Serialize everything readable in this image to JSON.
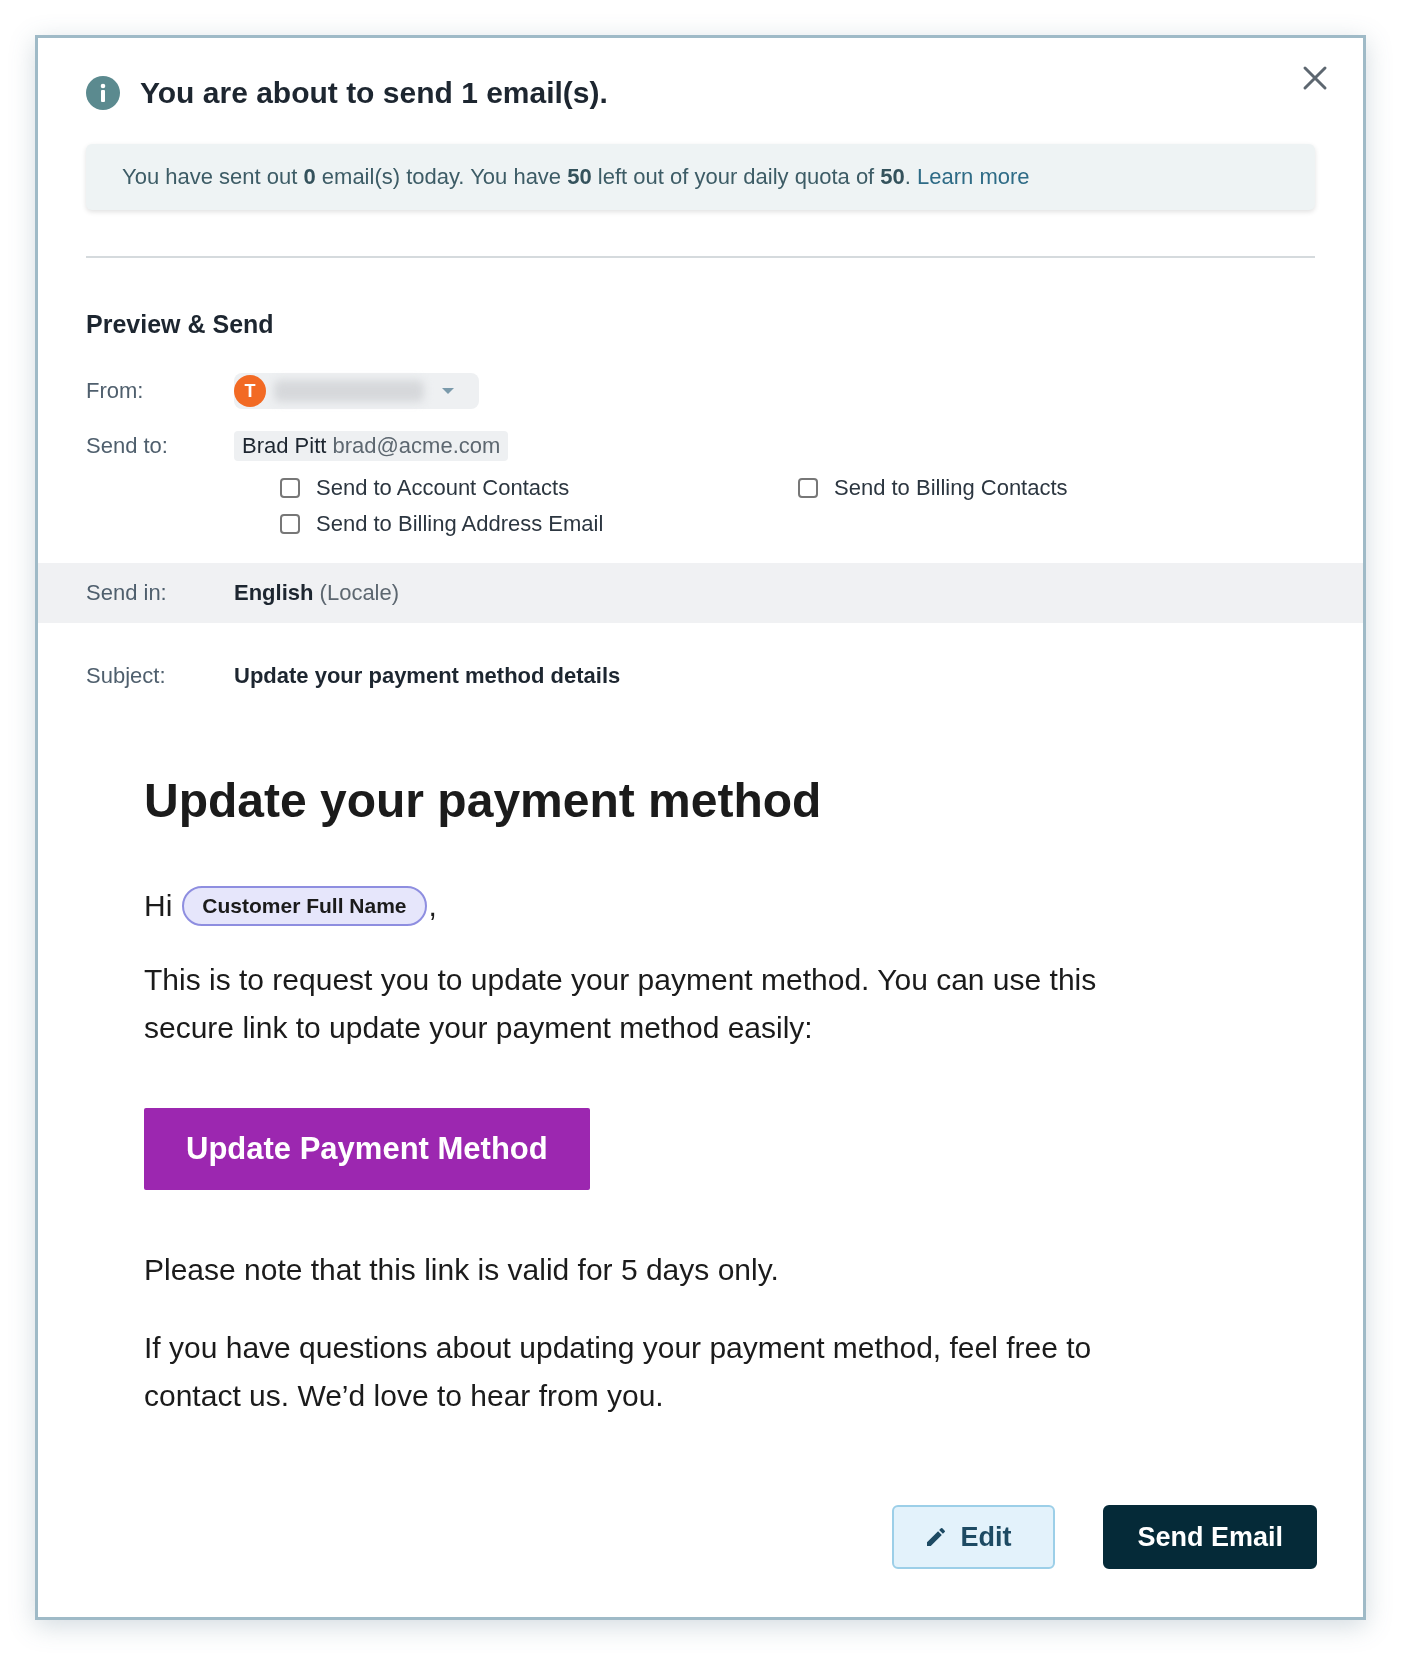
{
  "dialog": {
    "title": "You are about to send 1 email(s)."
  },
  "quota_banner": {
    "text": "You have sent out **0** email(s) today. You have **50** left out of your daily quota of **50**.",
    "link": "Learn more"
  },
  "section_title": "Preview & Send",
  "from": {
    "label": "From:",
    "avatar_letter": "T"
  },
  "send_to": {
    "label": "Send to:",
    "name": "Brad Pitt",
    "email": "brad@acme.com",
    "options": [
      {
        "label": "Send to Account Contacts",
        "checked": false
      },
      {
        "label": "Send to Billing Contacts",
        "checked": false
      },
      {
        "label": "Send to Billing Address Email",
        "checked": false
      }
    ]
  },
  "send_in": {
    "label": "Send in:",
    "language": "English",
    "note": "(Locale)"
  },
  "subject": {
    "label": "Subject:",
    "value": "Update your payment method details"
  },
  "email": {
    "heading": "Update your payment method",
    "greeting": "Hi",
    "merge_tag": "Customer Full Name",
    "greeting_end": ",",
    "intro": "This is to request you to update your payment method. You can use this secure link to update your payment method easily:",
    "button": "Update Payment Method",
    "notes": [
      "Please note that this link is valid for 5 days only.",
      "If you have questions about updating your payment method, feel free to contact us. We’d love to hear from you."
    ]
  },
  "actions": [
    {
      "label": "Edit",
      "kind": "secondary"
    },
    {
      "label": "Send Email",
      "kind": "primary"
    }
  ]
}
